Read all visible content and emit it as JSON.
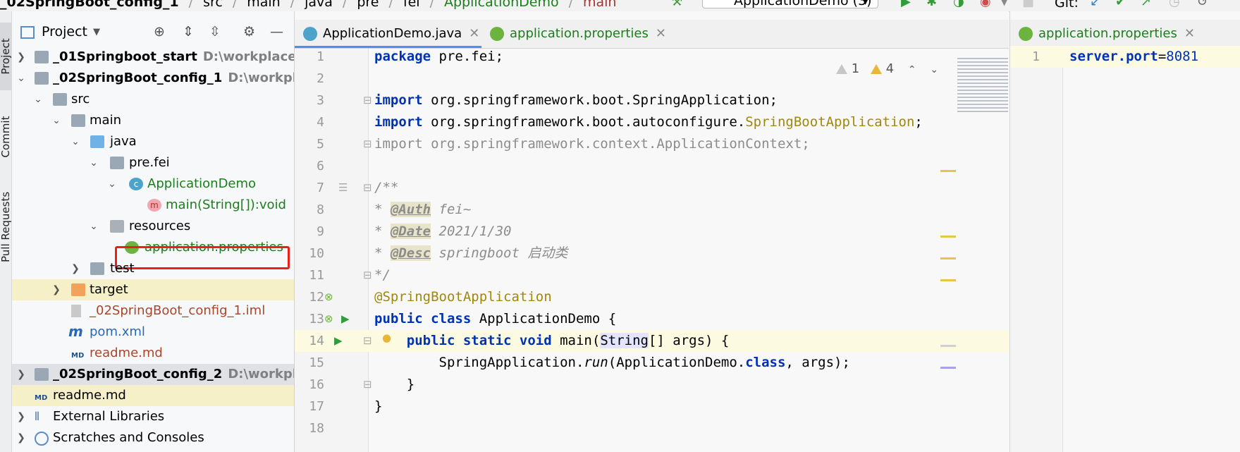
{
  "breadcrumbs": [
    "_02SpringBoot_config_1",
    "src",
    "main",
    "java",
    "pre",
    "fei",
    "ApplicationDemo",
    "main"
  ],
  "toolbar": {
    "run_config": "ApplicationDemo (3)",
    "git_label": "Git:",
    "icons": [
      "hammer-icon",
      "run-icon",
      "debug-icon",
      "coverage-icon",
      "profile-icon",
      "stop-icon",
      "git-update-icon",
      "git-commit-icon",
      "git-push-icon",
      "history-icon",
      "rollback-icon"
    ]
  },
  "tool_stripe": {
    "project": "Project",
    "commit": "Commit",
    "pull_requests": "Pull Requests"
  },
  "project_panel": {
    "title": "Project",
    "tree": [
      {
        "label": "_01Springboot_start",
        "path": "D:\\workplace\\java",
        "expanded": false
      },
      {
        "label": "_02SpringBoot_config_1",
        "path": "D:\\workplace",
        "expanded": true
      },
      {
        "label": "src"
      },
      {
        "label": "main"
      },
      {
        "label": "java"
      },
      {
        "label": "pre.fei"
      },
      {
        "label": "ApplicationDemo"
      },
      {
        "label": "main(String[]):void"
      },
      {
        "label": "resources"
      },
      {
        "label": "application.properties"
      },
      {
        "label": "test"
      },
      {
        "label": "target"
      },
      {
        "label": "_02SpringBoot_config_1.iml"
      },
      {
        "label": "pom.xml"
      },
      {
        "label": "readme.md"
      },
      {
        "label": "_02SpringBoot_config_2",
        "path": "D:\\workplace"
      },
      {
        "label": "readme.md"
      },
      {
        "label": "External Libraries"
      },
      {
        "label": "Scratches and Consoles"
      }
    ]
  },
  "editor1": {
    "tabs": [
      {
        "label": "ApplicationDemo.java",
        "active": true
      },
      {
        "label": "application.properties",
        "active": false
      }
    ],
    "inspections": {
      "weak_warnings": "1",
      "warnings": "4"
    },
    "line_numbers": [
      "1",
      "2",
      "3",
      "4",
      "5",
      "6",
      "7",
      "8",
      "9",
      "10",
      "11",
      "12",
      "13",
      "14",
      "15",
      "16",
      "17",
      "18"
    ],
    "code": {
      "l1_kw": "package",
      "l1_rest": " pre.fei;",
      "l3_kw": "import",
      "l3_rest": " org.springframework.boot.SpringApplication;",
      "l4_kw": "import",
      "l4_rest": " org.springframework.boot.autoconfigure.",
      "l4_anno": "SpringBootApplication",
      "l4_end": ";",
      "l5_kw": "import",
      "l5_rest": " org.springframework.context.ApplicationContext;",
      "l7": "/**",
      "l8_star": " * ",
      "l8_tag": "@Auth",
      "l8_val": " fei~",
      "l9_star": " * ",
      "l9_tag": "@Date",
      "l9_val": " 2021/1/30",
      "l10_star": " * ",
      "l10_tag": "@Desc",
      "l10_val": " springboot 启动类",
      "l11": " */",
      "l12": "@SpringBootApplication",
      "l13_kw": "public class",
      "l13_rest": " ApplicationDemo {",
      "l14_indent": "    ",
      "l14_kw": "public static void",
      "l14_a": " main(",
      "l14_str": "String",
      "l14_b": "[] args) {",
      "l15_a": "        SpringApplication.",
      "l15_run": "run",
      "l15_b": "(ApplicationDemo.",
      "l15_kw": "class",
      "l15_c": ", args);",
      "l16": "    }",
      "l17": "}"
    }
  },
  "editor2": {
    "tab": "application.properties",
    "line_number": "1",
    "key": "server.port",
    "eq": "=",
    "value": "8081"
  },
  "colors": {
    "accent": "#4f8ef0",
    "selection_outline": "#e8221b",
    "keyword": "#0033b3",
    "annotation": "#9e880d"
  }
}
